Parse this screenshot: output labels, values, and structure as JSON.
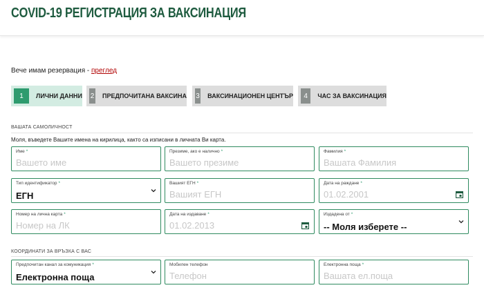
{
  "header": {
    "title": "COVID-19 РЕГИСТРАЦИЯ ЗА ВАКСИНАЦИЯ"
  },
  "reservation": {
    "text": "Вече имам резервация - ",
    "link": "преглед"
  },
  "steps": [
    {
      "num": "1",
      "label": "ЛИЧНИ ДАННИ"
    },
    {
      "num": "2",
      "label": "ПРЕДПОЧИТАНА ВАКСИНА"
    },
    {
      "num": "3",
      "label": "ВАКСИНАЦИОНЕН ЦЕНТЪР"
    },
    {
      "num": "4",
      "label": "ЧАС ЗА ВАКСИНАЦИЯ"
    }
  ],
  "identity": {
    "title": "ВАШАТА САМОЛИЧНОСТ",
    "instruction": "Моля, въведете Вашите имена на кирилица, както са изписани в личната Ви карта.",
    "first_name": {
      "label": "Име",
      "placeholder": "Вашето име"
    },
    "middle_name": {
      "label": "Презиме, ако е налично",
      "placeholder": "Вашето презиме"
    },
    "last_name": {
      "label": "Фамилия",
      "placeholder": "Вашата Фамилия"
    },
    "id_type": {
      "label": "Тип идентификатор",
      "value": "ЕГН"
    },
    "egn": {
      "label": "Вашият ЕГН",
      "placeholder": "Вашият ЕГН"
    },
    "birth_date": {
      "label": "Дата на раждане",
      "placeholder": "01.02.2001"
    },
    "id_number": {
      "label": "Номер на лична карта",
      "placeholder": "Номер на ЛК"
    },
    "issue_date": {
      "label": "Дата на издаване",
      "placeholder": "01.02.2013"
    },
    "issued_by": {
      "label": "Издадена от",
      "value": "-- Моля изберете --"
    }
  },
  "contacts": {
    "title": "КООРДИНАТИ ЗА ВРЪЗКА С ВАС",
    "channel": {
      "label": "Предпочитан канал за комуникация",
      "value": "Електронна поща"
    },
    "phone": {
      "label": "Мобилен телефон",
      "placeholder": "Телефон"
    },
    "email": {
      "label": "Електронна поща",
      "placeholder": "Вашата ел.поща"
    }
  },
  "colors": {
    "brand": "#1e5b3f",
    "accent": "#2e9b6e",
    "active_step_bg": "#d3ece2",
    "link": "#b00000"
  }
}
